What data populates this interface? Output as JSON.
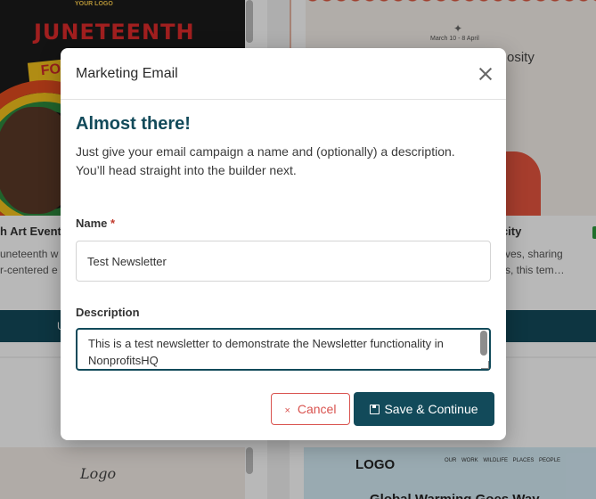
{
  "background": {
    "cards": [
      {
        "poster_logo": "YOUR LOGO",
        "poster_title": "JUNETEENTH",
        "poster_banner": "FO",
        "name": "h Art Event",
        "desc_line1": "uneteenth w",
        "desc_line2": "r-centered e",
        "button_label": "U"
      },
      {
        "poster_date": "March 10 - 8 April",
        "poster_star": "✦",
        "poster_word": "osity",
        "name": "ocity",
        "desc_line1": "ves, sharing",
        "desc_line2": "s, this tem…"
      },
      {
        "signature": "Logo"
      },
      {
        "logo": "LOGO",
        "nav": "OUR WORK WILDLIFE PLACES PEOPLE",
        "title": "Global Warming Goes Way"
      }
    ]
  },
  "modal": {
    "title": "Marketing Email",
    "heading": "Almost there!",
    "intro": "Just give your email campaign a name and (optionally) a description. You’ll head straight into the builder next.",
    "name_label": "Name",
    "required_mark": "*",
    "name_value": "Test Newsletter",
    "description_label": "Description",
    "description_value": "This is a test newsletter to demonstrate the Newsletter functionality in NonprofitsHQ",
    "cancel_icon": "×",
    "cancel_label": "Cancel",
    "save_icon": "save-icon",
    "save_label": "Save & Continue"
  },
  "colors": {
    "primary": "#124a5a",
    "danger": "#d9534f",
    "required": "#c0392b"
  }
}
